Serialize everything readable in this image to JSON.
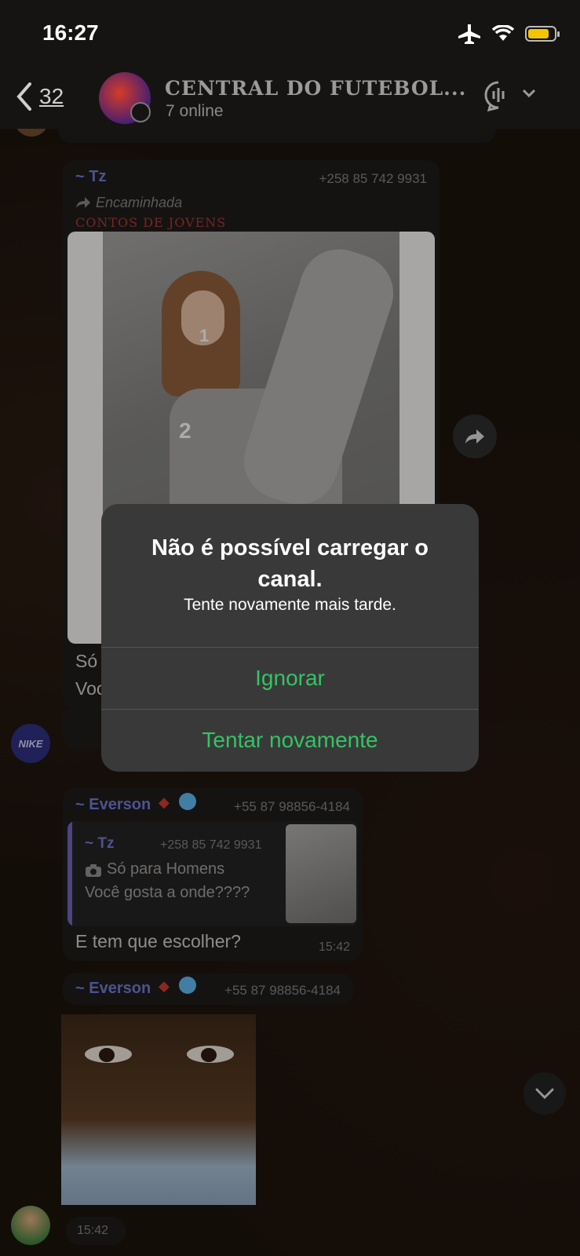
{
  "status_bar": {
    "time": "16:27"
  },
  "header": {
    "back_count": "32",
    "title": "CENTRAL DO FUTEBOL...",
    "subtitle": "7 online"
  },
  "messages": [
    {
      "sender": "~ Tz",
      "phone": "+258 85 742 9931",
      "forwarded_label": "Encaminhada",
      "forwarded_source": "CONTOS DE JOVENS",
      "text_partial_1": "Só",
      "text_partial_2": "Voc",
      "photo_labels": [
        "1",
        "2"
      ]
    },
    {
      "sender": "~ Everson",
      "phone": "+55 87 98856-4184",
      "quote_sender": "~ Tz",
      "quote_phone": "+258 85 742 9931",
      "quote_line1": "Só para Homens",
      "quote_line2": "Você gosta a onde????",
      "text": "E tem que escolher?",
      "time": "15:42"
    },
    {
      "sender": "~ Everson",
      "phone": "+55 87 98856-4184",
      "time": "15:42"
    }
  ],
  "alert": {
    "title": "Não é possível carregar o canal.",
    "message": "Tente novamente mais tarde.",
    "ignore_label": "Ignorar",
    "retry_label": "Tentar novamente"
  },
  "avatars": {
    "nike_text": "NIKE"
  },
  "colors": {
    "accent_green": "#35c365",
    "sender_purple": "#6b72c9",
    "battery": "#f5c400"
  }
}
